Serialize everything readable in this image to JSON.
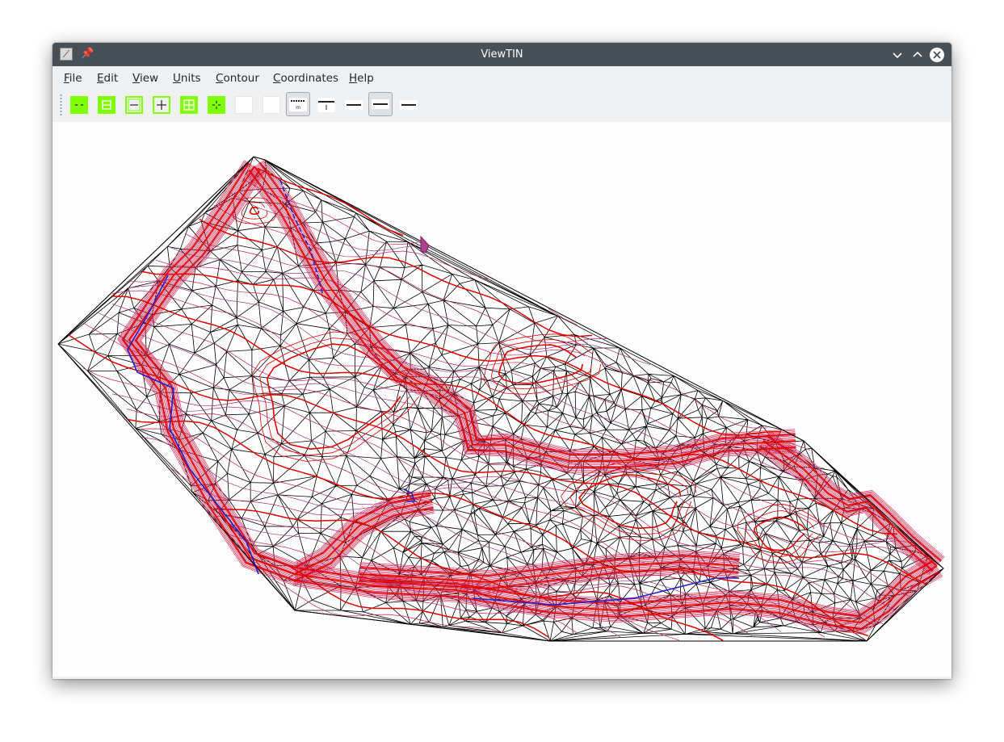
{
  "window": {
    "title": "ViewTIN"
  },
  "menu": [
    {
      "key": "F",
      "rest": "ile"
    },
    {
      "key": "E",
      "rest": "dit"
    },
    {
      "key": "V",
      "rest": "iew"
    },
    {
      "key": "U",
      "rest": "nits"
    },
    {
      "key": "C",
      "rest": "ontour"
    },
    {
      "key": "C",
      "rest": "oordinates"
    },
    {
      "key": "H",
      "rest": "elp"
    }
  ],
  "toolbar": {
    "tools": [
      {
        "icon": "zoom-out-icon"
      },
      {
        "icon": "zoom-equal-icon"
      },
      {
        "icon": "minus-icon"
      },
      {
        "icon": "plus-icon"
      },
      {
        "icon": "grid-plus-icon"
      },
      {
        "icon": "crosshair-icon"
      },
      {
        "icon": "blank-icon"
      },
      {
        "icon": "blank-icon"
      },
      {
        "icon": "scale-ruler-icon",
        "checked": true
      },
      {
        "icon": "elevation-bar-icon"
      },
      {
        "icon": "bar-icon"
      },
      {
        "icon": "bar-icon",
        "checked": true
      },
      {
        "icon": "bar-icon"
      }
    ]
  },
  "colors": {
    "titlebar": "#475057",
    "accent_green": "#7fff00",
    "tin_edges": "#000000",
    "contour_major": "#e00000",
    "contour_minor": "#c02060",
    "breakline": "#2020cc"
  }
}
